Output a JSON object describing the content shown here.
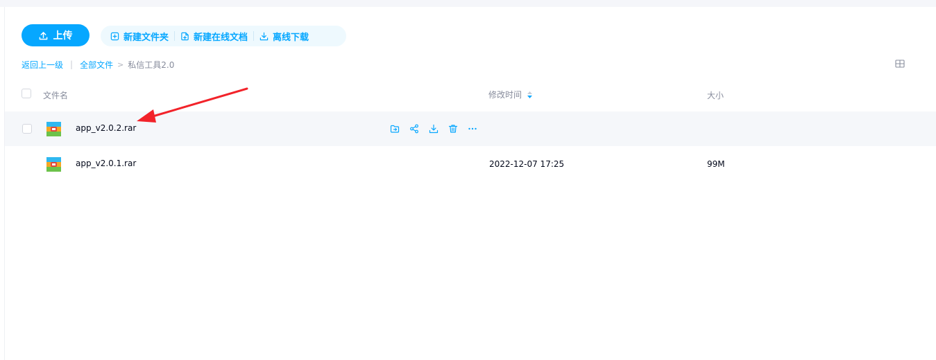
{
  "toolbar": {
    "upload_label": "上传",
    "new_folder_label": "新建文件夹",
    "new_doc_label": "新建在线文档",
    "offline_download_label": "离线下载"
  },
  "breadcrumb": {
    "back_label": "返回上一级",
    "separator": "|",
    "all_files_label": "全部文件",
    "arrow": ">",
    "current_folder": "私信工具2.0"
  },
  "list_header": {
    "name_label": "文件名",
    "time_label": "修改时间",
    "size_label": "大小"
  },
  "files": [
    {
      "name": "app_v2.0.2.rar",
      "modified": "",
      "size": "",
      "hovered": true
    },
    {
      "name": "app_v2.0.1.rar",
      "modified": "2022-12-07 17:25",
      "size": "99M",
      "hovered": false
    }
  ],
  "row_action_icons": [
    "move-to-folder-icon",
    "share-icon",
    "download-icon",
    "delete-icon",
    "more-icon"
  ],
  "colors": {
    "accent": "#06a7ff",
    "annotation_arrow": "#f2232a",
    "row_hover_bg": "#f5f7fa"
  }
}
